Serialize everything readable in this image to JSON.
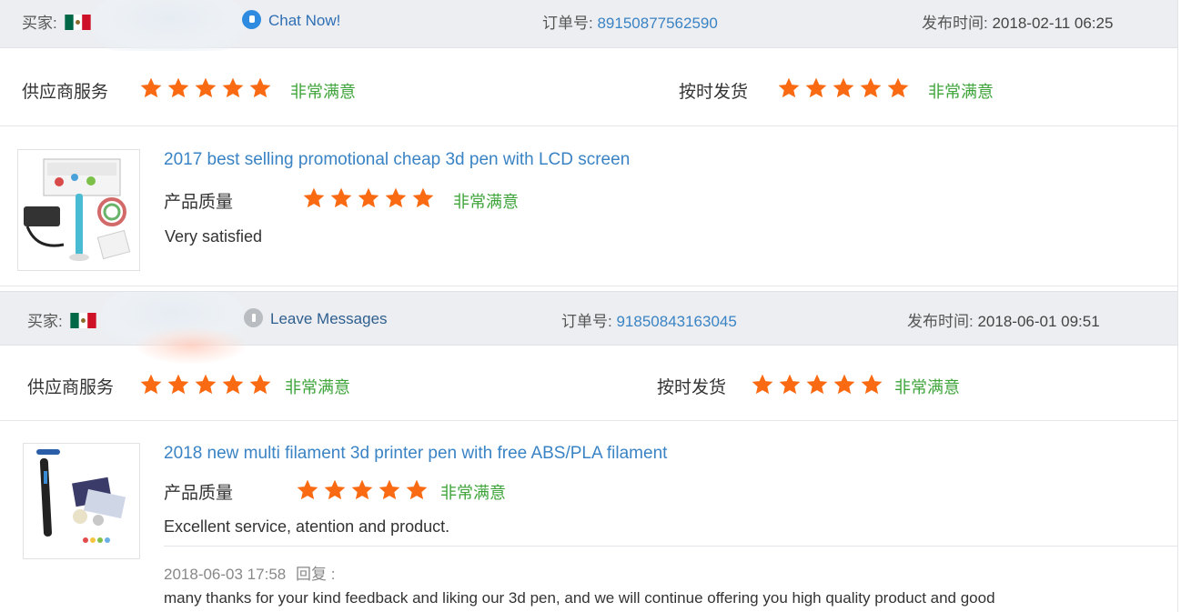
{
  "reviews": [
    {
      "buyer_label": "买家:",
      "contact_label": "Chat Now!",
      "order_label": "订单号:",
      "order_number": "89150877562590",
      "time_label": "发布时间:",
      "time_value": "2018-02-11 06:25",
      "supplier_service": {
        "label": "供应商服务",
        "rating": 5,
        "text": "非常满意"
      },
      "on_time": {
        "label": "按时发货",
        "rating": 5,
        "text": "非常满意"
      },
      "product": {
        "title": "2017 best selling promotional cheap 3d pen with LCD screen",
        "quality_label": "产品质量",
        "rating": 5,
        "quality_text": "非常满意",
        "comment": "Very satisfied"
      }
    },
    {
      "buyer_label": "买家:",
      "contact_label": "Leave Messages",
      "order_label": "订单号:",
      "order_number": "91850843163045",
      "time_label": "发布时间:",
      "time_value": "2018-06-01 09:51",
      "supplier_service": {
        "label": "供应商服务",
        "rating": 5,
        "text": "非常满意"
      },
      "on_time": {
        "label": "按时发货",
        "rating": 5,
        "text": "非常满意"
      },
      "product": {
        "title": "2018 new multi filament 3d printer pen with free ABS/PLA filament",
        "quality_label": "产品质量",
        "rating": 5,
        "quality_text": "非常满意",
        "comment": "Excellent service, atention and product."
      },
      "reply": {
        "time": "2018-06-03 17:58",
        "label": "回复 :",
        "text": "many thanks for your kind feedback and liking our 3d pen, and we will continue offering you high quality product and good"
      }
    }
  ],
  "colors": {
    "star": "#f96a12",
    "link": "#3a83c4",
    "satisfied": "#3ea43a"
  },
  "icons": {
    "flag": "mexico-flag-icon",
    "star": "star-icon",
    "chat": "chat-icon",
    "message": "message-icon"
  }
}
